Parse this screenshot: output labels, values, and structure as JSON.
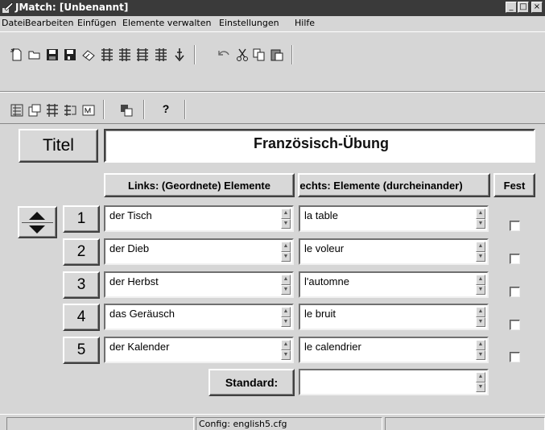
{
  "window": {
    "title": "JMatch: [Unbenannt]",
    "controls": {
      "minimize": "_",
      "maximize": "□",
      "close": "×"
    }
  },
  "menu": [
    "Datei",
    "Bearbeiten",
    "Einfügen",
    "Elemente verwalten",
    "Einstellungen",
    "Hilfe"
  ],
  "toolbar": {
    "row1": [
      "new-file-icon",
      "open-folder-icon",
      "save-icon",
      "save-as-icon",
      "clear-icon",
      "export-web-icon-1",
      "export-web-icon-2",
      "export-web-icon-3",
      "export-web-icon-4",
      "down-arrow-icon",
      "undo-icon",
      "cut-icon",
      "copy-icon",
      "paste-icon"
    ],
    "row2": [
      "config-icon-1",
      "config-icon-2",
      "config-icon-3",
      "config-icon-4",
      "format-icon",
      "mask-icon",
      "help-icon"
    ],
    "help_label": "?"
  },
  "form": {
    "title_label": "Titel",
    "title_value": "Französisch-Übung",
    "col_left": "Links: (Geordnete) Elemente",
    "col_right": "Rechts: Elemente (durcheinander)",
    "col_fixed": "Fest",
    "rows": [
      {
        "num": "1",
        "left": "der Tisch",
        "right": "la table",
        "fixed": false
      },
      {
        "num": "2",
        "left": "der Dieb",
        "right": "le voleur",
        "fixed": false
      },
      {
        "num": "3",
        "left": "der Herbst",
        "right": "l'automne",
        "fixed": false
      },
      {
        "num": "4",
        "left": "das Geräusch",
        "right": "le bruit",
        "fixed": false
      },
      {
        "num": "5",
        "left": "der Kalender",
        "right": "le calendrier",
        "fixed": false
      }
    ],
    "default_label": "Standard:",
    "default_value": ""
  },
  "status": {
    "config": "Config: english5.cfg"
  },
  "colors": {
    "titlebar": "#3a3a3a",
    "face": "#d6d6d6",
    "field": "#ffffff"
  }
}
